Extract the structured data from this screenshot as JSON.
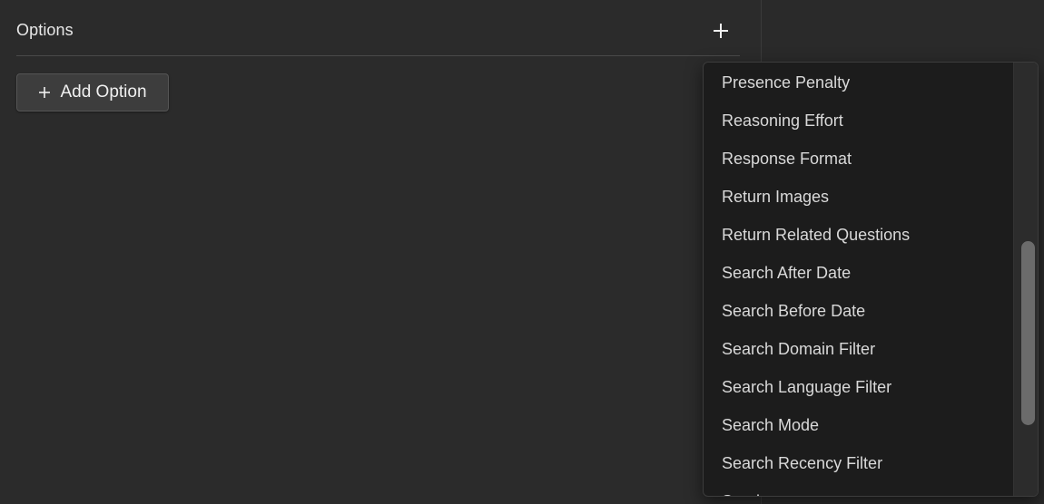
{
  "options": {
    "title": "Options",
    "add_button_label": "Add Option"
  },
  "dropdown": {
    "items": [
      "Presence Penalty",
      "Reasoning Effort",
      "Response Format",
      "Return Images",
      "Return Related Questions",
      "Search After Date",
      "Search Before Date",
      "Search Domain Filter",
      "Search Language Filter",
      "Search Mode",
      "Search Recency Filter",
      "Seed"
    ],
    "scroll_position_fraction": 0.41
  },
  "icons": {
    "header_add": "plus-icon",
    "button_add": "plus-icon"
  },
  "colors": {
    "background": "#2b2b2b",
    "dropdown_background": "#1c1c1c",
    "button_background": "#3d3d3d",
    "text": "#e6e6e6"
  }
}
